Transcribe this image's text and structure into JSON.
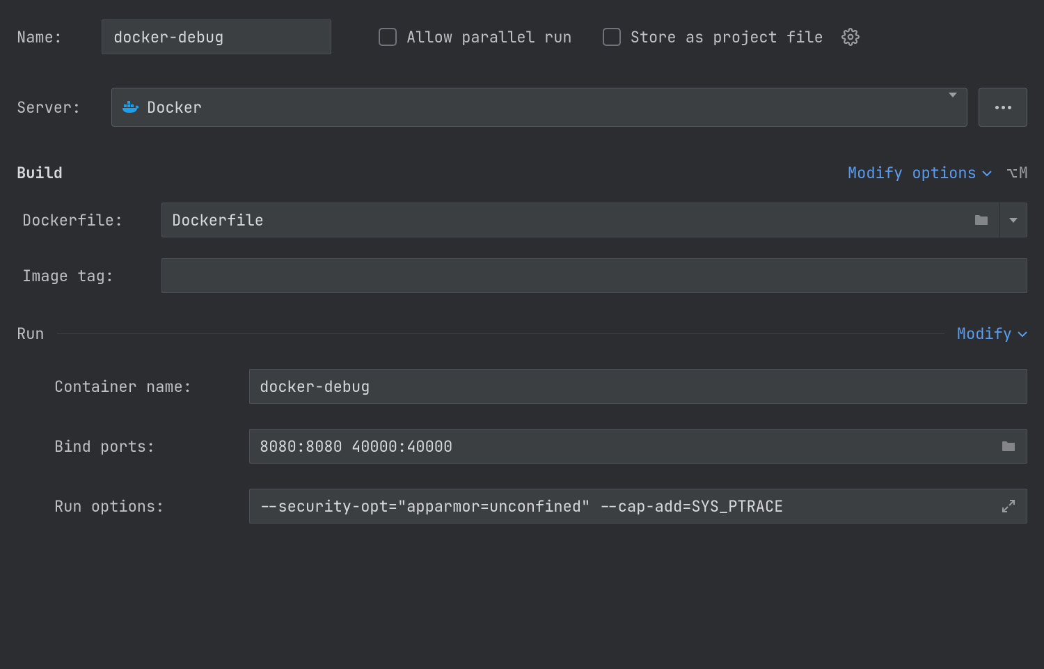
{
  "name": {
    "label": "Name:",
    "value": "docker-debug"
  },
  "checkboxes": {
    "allow_parallel": "Allow parallel run",
    "store_project": "Store as project file"
  },
  "server": {
    "label": "Server:",
    "value": "Docker"
  },
  "build": {
    "title": "Build",
    "modify_label": "Modify options",
    "shortcut": "M",
    "dockerfile": {
      "label": "Dockerfile:",
      "value": "Dockerfile"
    },
    "image_tag": {
      "label": "Image tag:",
      "value": ""
    }
  },
  "run": {
    "title": "Run",
    "modify_label": "Modify",
    "container_name": {
      "label": "Container name:",
      "value": "docker-debug"
    },
    "bind_ports": {
      "label": "Bind ports:",
      "value": "8080:8080 40000:40000"
    },
    "run_options": {
      "label": "Run options:",
      "value": "--security-opt=\"apparmor=unconfined\" --cap-add=SYS_PTRACE"
    }
  }
}
